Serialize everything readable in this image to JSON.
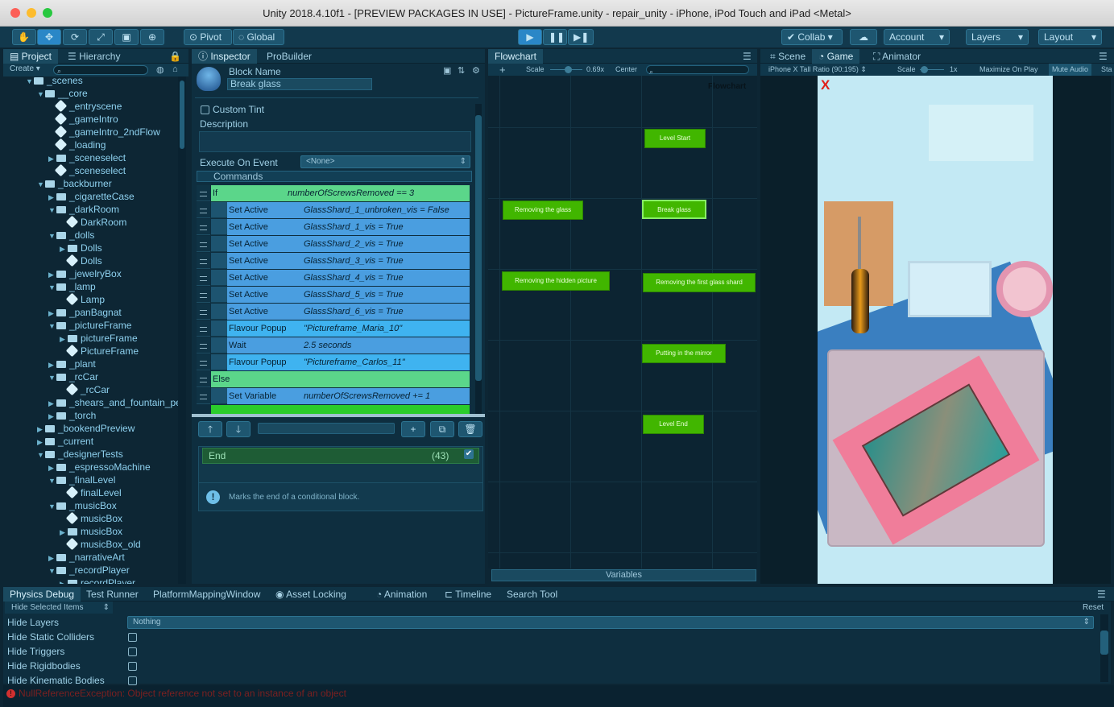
{
  "window": {
    "title": "Unity 2018.4.10f1 - [PREVIEW PACKAGES IN USE] - PictureFrame.unity - repair_unity - iPhone, iPod Touch and iPad <Metal>"
  },
  "toolbar": {
    "pivot": "Pivot",
    "global": "Global",
    "collab": "Collab",
    "account": "Account",
    "layers": "Layers",
    "layout": "Layout"
  },
  "project": {
    "tab_project": "Project",
    "tab_hierarchy": "Hierarchy",
    "create": "Create",
    "tree": [
      {
        "label": "_scenes",
        "depth": 1,
        "kind": "folder",
        "open": true
      },
      {
        "label": "__core",
        "depth": 2,
        "kind": "folder",
        "open": true
      },
      {
        "label": "_entryscene",
        "depth": 3,
        "kind": "scene"
      },
      {
        "label": "_gameIntro",
        "depth": 3,
        "kind": "scene"
      },
      {
        "label": "_gameIntro_2ndFlow",
        "depth": 3,
        "kind": "scene"
      },
      {
        "label": "_loading",
        "depth": 3,
        "kind": "scene"
      },
      {
        "label": "_sceneselect",
        "depth": 3,
        "kind": "folder",
        "open": false
      },
      {
        "label": "_sceneselect",
        "depth": 3,
        "kind": "scene"
      },
      {
        "label": "_backburner",
        "depth": 2,
        "kind": "folder",
        "open": true
      },
      {
        "label": "_cigaretteCase",
        "depth": 3,
        "kind": "folder",
        "open": false
      },
      {
        "label": "_darkRoom",
        "depth": 3,
        "kind": "folder",
        "open": true
      },
      {
        "label": "DarkRoom",
        "depth": 4,
        "kind": "scene"
      },
      {
        "label": "_dolls",
        "depth": 3,
        "kind": "folder",
        "open": true
      },
      {
        "label": "Dolls",
        "depth": 4,
        "kind": "folder",
        "open": false
      },
      {
        "label": "Dolls",
        "depth": 4,
        "kind": "scene"
      },
      {
        "label": "_jewelryBox",
        "depth": 3,
        "kind": "folder",
        "open": false
      },
      {
        "label": "_lamp",
        "depth": 3,
        "kind": "folder",
        "open": true
      },
      {
        "label": "Lamp",
        "depth": 4,
        "kind": "scene"
      },
      {
        "label": "_panBagnat",
        "depth": 3,
        "kind": "folder",
        "open": false
      },
      {
        "label": "_pictureFrame",
        "depth": 3,
        "kind": "folder",
        "open": true
      },
      {
        "label": "pictureFrame",
        "depth": 4,
        "kind": "folder",
        "open": false
      },
      {
        "label": "PictureFrame",
        "depth": 4,
        "kind": "scene"
      },
      {
        "label": "_plant",
        "depth": 3,
        "kind": "folder",
        "open": false
      },
      {
        "label": "_rcCar",
        "depth": 3,
        "kind": "folder",
        "open": true
      },
      {
        "label": "_rcCar",
        "depth": 4,
        "kind": "scene"
      },
      {
        "label": "_shears_and_fountain_pe",
        "depth": 3,
        "kind": "folder",
        "open": false
      },
      {
        "label": "_torch",
        "depth": 3,
        "kind": "folder",
        "open": false
      },
      {
        "label": "_bookendPreview",
        "depth": 2,
        "kind": "folder",
        "open": false
      },
      {
        "label": "_current",
        "depth": 2,
        "kind": "folder",
        "open": false
      },
      {
        "label": "_designerTests",
        "depth": 2,
        "kind": "folder",
        "open": true
      },
      {
        "label": "_espressoMachine",
        "depth": 3,
        "kind": "folder",
        "open": false
      },
      {
        "label": "_finalLevel",
        "depth": 3,
        "kind": "folder",
        "open": true
      },
      {
        "label": "finalLevel",
        "depth": 4,
        "kind": "scene"
      },
      {
        "label": "_musicBox",
        "depth": 3,
        "kind": "folder",
        "open": true
      },
      {
        "label": "musicBox",
        "depth": 4,
        "kind": "scene"
      },
      {
        "label": "musicBox",
        "depth": 4,
        "kind": "folder",
        "open": false
      },
      {
        "label": "musicBox_old",
        "depth": 4,
        "kind": "scene"
      },
      {
        "label": "_narrativeArt",
        "depth": 3,
        "kind": "folder",
        "open": false
      },
      {
        "label": "_recordPlayer",
        "depth": 3,
        "kind": "folder",
        "open": true
      },
      {
        "label": "recordPlayer",
        "depth": 4,
        "kind": "folder",
        "open": false
      }
    ]
  },
  "inspector": {
    "tab_inspector": "Inspector",
    "tab_probuilder": "ProBuilder",
    "block_name_label": "Block Name",
    "block_name": "Break glass",
    "custom_tint": "Custom Tint",
    "description": "Description",
    "execute_on_event": "Execute On Event",
    "event_value": "<None>",
    "commands_header": "Commands",
    "commands": [
      {
        "k": "If",
        "v": "numberOfScrewsRemoved == 3",
        "type": "if"
      },
      {
        "k": "Set Active",
        "v": "GlassShard_1_unbroken_vis = False",
        "type": "set"
      },
      {
        "k": "Set Active",
        "v": "GlassShard_1_vis = True",
        "type": "set"
      },
      {
        "k": "Set Active",
        "v": "GlassShard_2_vis = True",
        "type": "set"
      },
      {
        "k": "Set Active",
        "v": "GlassShard_3_vis = True",
        "type": "set"
      },
      {
        "k": "Set Active",
        "v": "GlassShard_4_vis = True",
        "type": "set"
      },
      {
        "k": "Set Active",
        "v": "GlassShard_5_vis = True",
        "type": "set"
      },
      {
        "k": "Set Active",
        "v": "GlassShard_6_vis = True",
        "type": "set"
      },
      {
        "k": "Flavour Popup",
        "v": "\"Pictureframe_Maria_10\"",
        "type": "popup"
      },
      {
        "k": "Wait",
        "v": "2.5 seconds",
        "type": "set"
      },
      {
        "k": "Flavour Popup",
        "v": "\"Pictureframe_Carlos_11\"",
        "type": "popup"
      },
      {
        "k": "Else",
        "v": "",
        "type": "if"
      },
      {
        "k": "Set Variable",
        "v": "numberOfScrewsRemoved += 1",
        "type": "set"
      }
    ],
    "selected_label": "End",
    "selected_index": "(43)",
    "help": "Marks the end of a conditional block."
  },
  "flowchart": {
    "tab": "Flowchart",
    "scale_label": "Scale",
    "scale_value": "0.69x",
    "center": "Center",
    "title": "Flowchart",
    "variables": "Variables",
    "nodes": [
      {
        "label": "Level Start",
        "id": "n1"
      },
      {
        "label": "Removing the glass",
        "id": "n2"
      },
      {
        "label": "Break glass",
        "id": "n3"
      },
      {
        "label": "Removing the hidden picture",
        "id": "n4"
      },
      {
        "label": "Removing the first glass shard",
        "id": "n5"
      },
      {
        "label": "Putting in the mirror",
        "id": "n6"
      },
      {
        "label": "Level End",
        "id": "n7"
      }
    ]
  },
  "game": {
    "tab_scene": "Scene",
    "tab_game": "Game",
    "tab_animator": "Animator",
    "aspect": "iPhone X Tall Ratio (90:195)",
    "scale_label": "Scale",
    "scale_value": "1x",
    "maximize": "Maximize On Play",
    "mute": "Mute Audio",
    "stats": "Sta",
    "close_mark": "X"
  },
  "bottom": {
    "tabs": [
      "Physics Debug",
      "Test Runner",
      "PlatformMappingWindow",
      "Asset Locking",
      "Animation",
      "Timeline",
      "Search Tool"
    ],
    "hide_selected": "Hide Selected Items",
    "reset": "Reset",
    "hide_layers": "Hide Layers",
    "layers_value": "Nothing",
    "rows": [
      "Hide Static Colliders",
      "Hide Triggers",
      "Hide Rigidbodies",
      "Hide Kinematic Bodies"
    ]
  },
  "status": {
    "error": "NullReferenceException: Object reference not set to an instance of an object"
  },
  "colors": {
    "accent": "#2a87c7",
    "node_green": "#41b600",
    "if_row": "#5bd68a",
    "set_row": "#4a9ee0",
    "popup_row": "#3fb3f0"
  }
}
